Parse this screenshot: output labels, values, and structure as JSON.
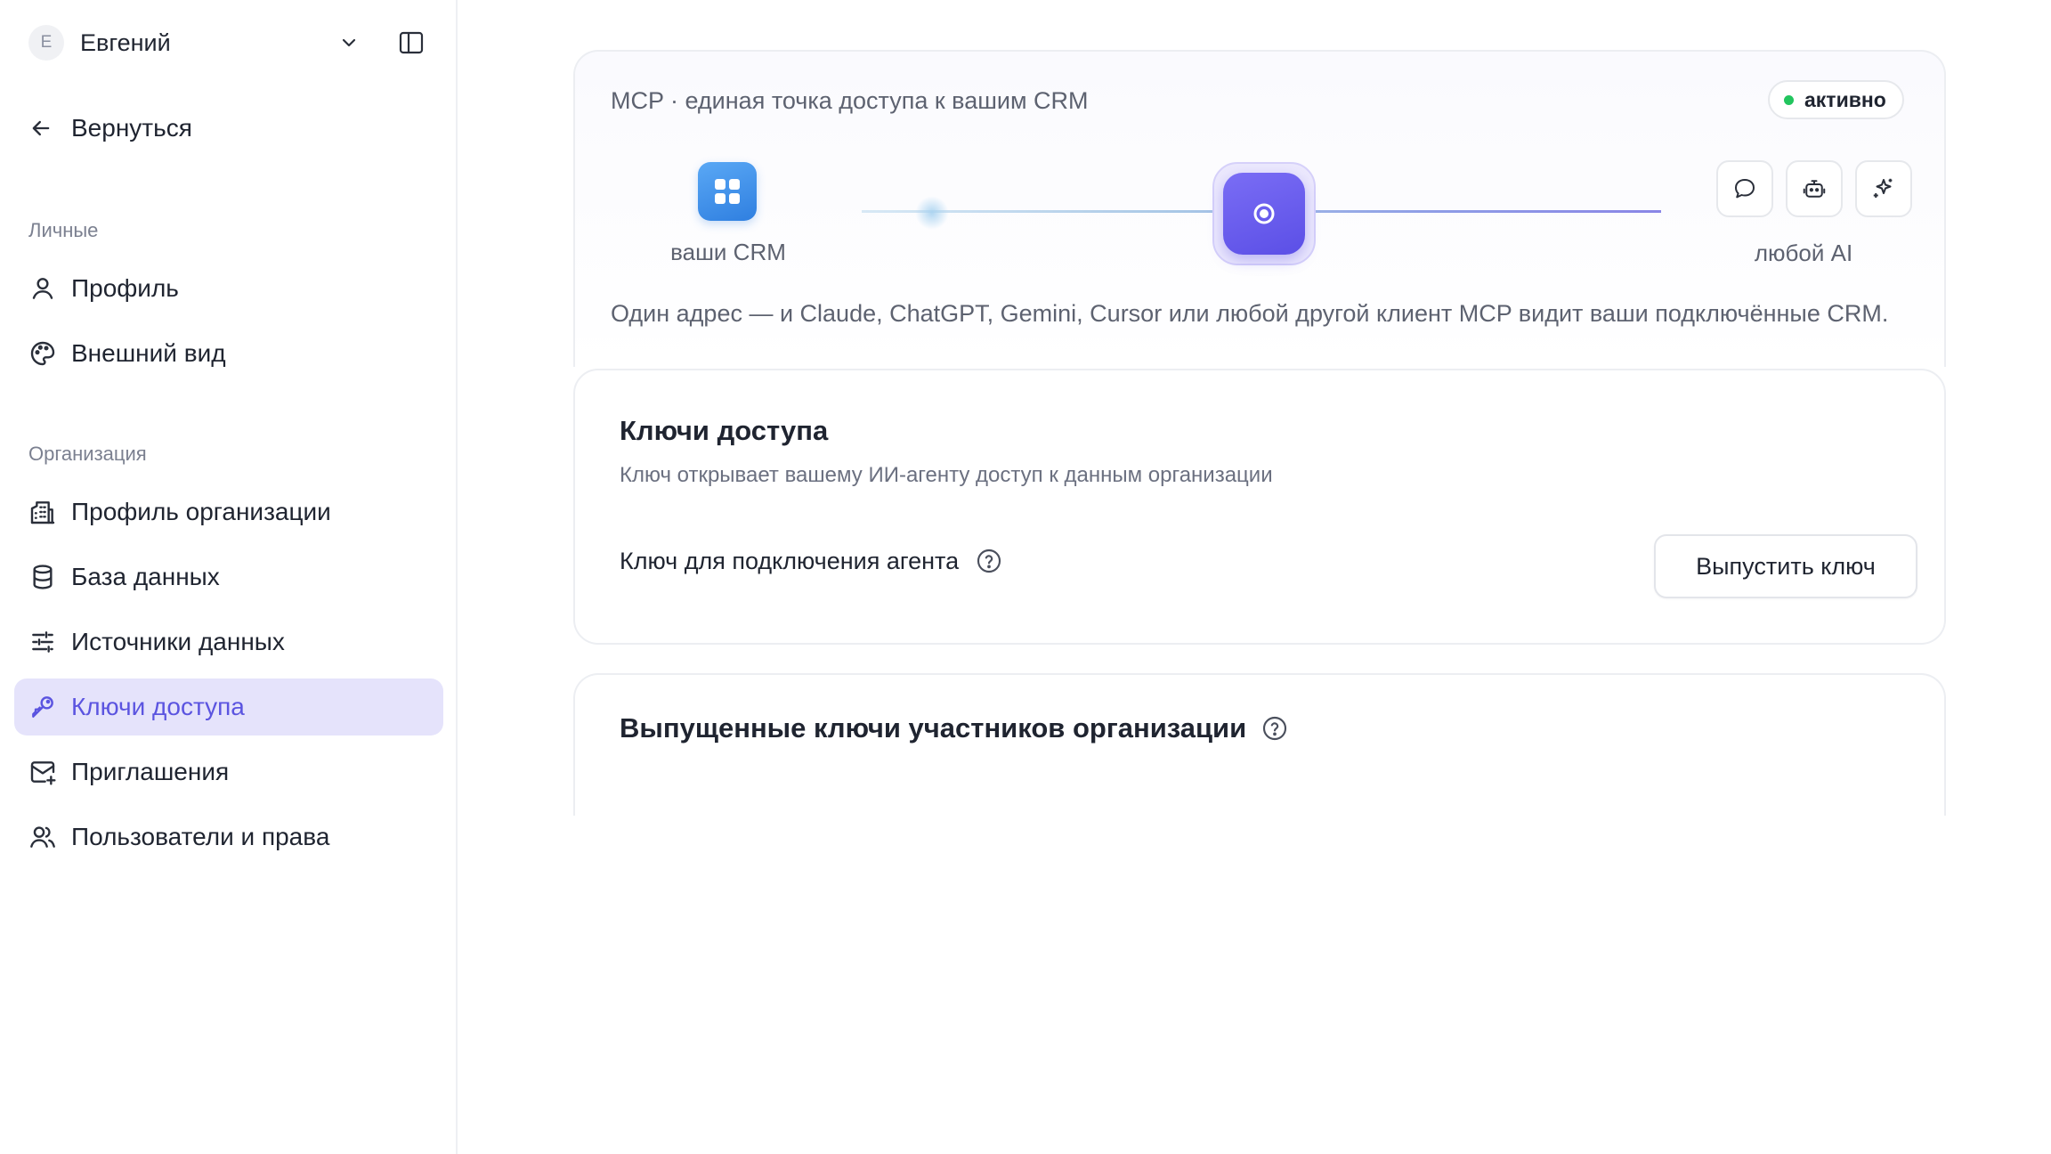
{
  "sidebar": {
    "user": {
      "initial": "E",
      "name": "Евгений"
    },
    "back_label": "Вернуться",
    "section_personal": "Личные",
    "personal_items": [
      {
        "label": "Профиль",
        "icon": "user-icon"
      },
      {
        "label": "Внешний вид",
        "icon": "palette-icon"
      }
    ],
    "section_org": "Организация",
    "org_items": [
      {
        "label": "Профиль организации",
        "icon": "building-icon"
      },
      {
        "label": "База данных",
        "icon": "database-icon"
      },
      {
        "label": "Источники данных",
        "icon": "sliders-icon"
      },
      {
        "label": "Ключи доступа",
        "icon": "key-icon",
        "active": true
      },
      {
        "label": "Приглашения",
        "icon": "mail-plus-icon"
      },
      {
        "label": "Пользователи и права",
        "icon": "users-icon"
      }
    ]
  },
  "mcp": {
    "title": "MCP · единая точка доступа к вашим CRM",
    "status": "активно",
    "crm_label": "ваши CRM",
    "ai_label": "любой AI",
    "description": "Один адрес — и Claude, ChatGPT, Gemini, Cursor или любой другой клиент MCP видит ваши подключённые CRM."
  },
  "keys": {
    "title": "Ключи доступа",
    "subtitle": "Ключ открывает вашему ИИ-агенту доступ к данным организации",
    "key_label": "Ключ для подключения агента",
    "issue_button": "Выпустить ключ"
  },
  "members": {
    "title": "Выпущенные ключи участников организации"
  },
  "colors": {
    "accent": "#5b54e0",
    "active_bg": "#e5e3fb",
    "status_green": "#22c55e",
    "crm_blue": "#2f7fe0"
  }
}
